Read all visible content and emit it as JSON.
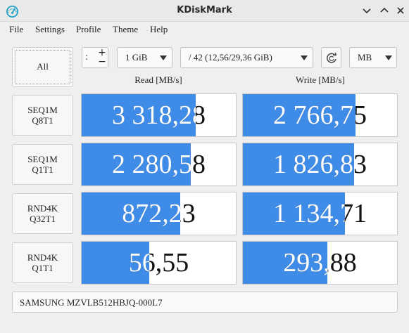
{
  "window": {
    "title": "KDiskMark"
  },
  "menu": [
    "File",
    "Settings",
    "Profile",
    "Theme",
    "Help"
  ],
  "toolbar": {
    "all_label": "All",
    "loops_value": ":",
    "plus": "+",
    "minus": "−",
    "size_value": "1 GiB",
    "drive_value": "/ 42 (12,56/29,36 GiB)",
    "unit_value": "MB"
  },
  "columns": {
    "read": "Read [MB/s]",
    "write": "Write [MB/s]"
  },
  "rows": [
    {
      "line1": "SEQ1M",
      "line2": "Q8T1",
      "read": "3 318,28",
      "read_level": 0.74,
      "write": "2 766,75",
      "write_level": 0.73
    },
    {
      "line1": "SEQ1M",
      "line2": "Q1T1",
      "read": "2 280,58",
      "read_level": 0.71,
      "write": "1 826,83",
      "write_level": 0.72
    },
    {
      "line1": "RND4K",
      "line2": "Q32T1",
      "read": "872,23",
      "read_level": 0.64,
      "write": "1 134,71",
      "write_level": 0.66
    },
    {
      "line1": "RND4K",
      "line2": "Q1T1",
      "read": "56,55",
      "read_level": 0.44,
      "write": "293,88",
      "write_level": 0.55
    }
  ],
  "device": "SAMSUNG MZVLB512HBJQ-000L7",
  "colors": {
    "bar": "#3f8ce8",
    "accent": "#2aa6c8"
  }
}
